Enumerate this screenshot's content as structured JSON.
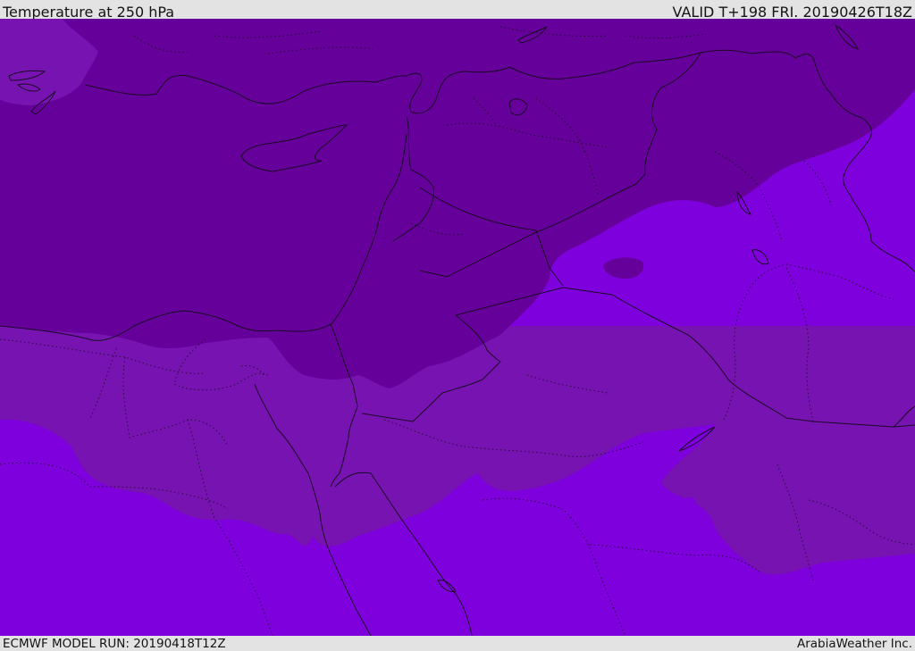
{
  "header": {
    "title": "Temperature at 250 hPa",
    "valid": "VALID T+198 FRI. 20190426T18Z"
  },
  "footer": {
    "model_run": "ECMWF MODEL RUN: 20190418T12Z",
    "credit": "ArabiaWeather Inc."
  },
  "map": {
    "fields": [
      {
        "band": "coldest",
        "color": "#66009a"
      },
      {
        "band": "middle",
        "color": "#7713b0"
      },
      {
        "band": "warmest",
        "color": "#7e00dc"
      }
    ],
    "border_color": "#1a0a26"
  }
}
